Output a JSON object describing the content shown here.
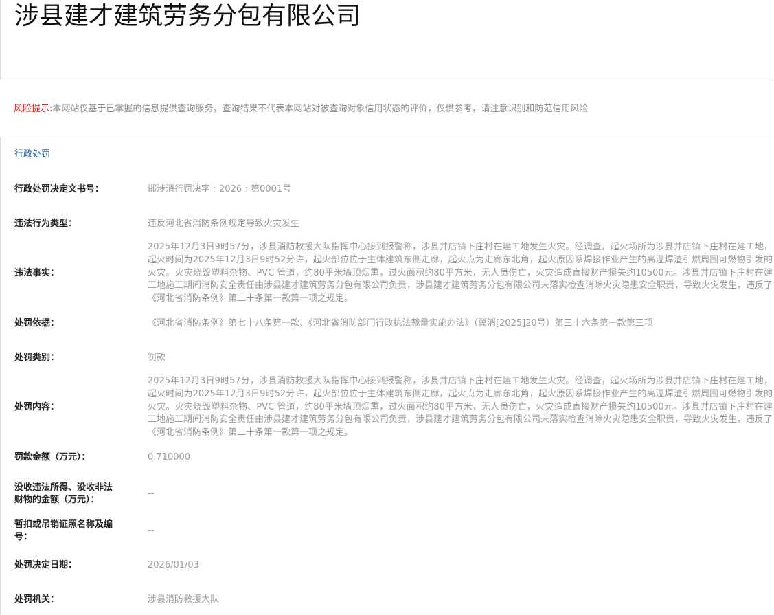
{
  "company": {
    "name": "涉县建才建筑劳务分包有限公司"
  },
  "risk": {
    "label": "风险提示:",
    "text": "本网站仅基于已掌握的信息提供查询服务，查询结果不代表本网站对被查询对象信用状态的评价，仅供参考，请注意识别和防范信用风险"
  },
  "section": {
    "title": "行政处罚"
  },
  "fields": [
    {
      "label": "行政处罚决定文书号：",
      "value": "邯涉消行罚决字﹝2026﹞第0001号"
    },
    {
      "label": "违法行为类型：",
      "value": "违反河北省消防条例规定导致火灾发生"
    },
    {
      "label": "违法事实：",
      "value": "2025年12月3日9时57分，涉县消防救援大队指挥中心接到报警称，涉县井店镇下庄村在建工地发生火灾。经调查，起火场所为涉县井店镇下庄村在建工地，起火时间为2025年12月3日9时52分许，起火部位位于主体建筑东侧走廊，起火点为走廊东北角，起火原因系焊接作业产生的高温焊渣引燃周围可燃物引发的火灾。火灾烧毁塑料杂物、PVC 管道，约80平米墙顶烟熏，过火面积约80平方米，无人员伤亡，火灾造成直接财产损失约10500元。涉县井店镇下庄村在建工地施工期间消防安全责任由涉县建才建筑劳务分包有限公司负责，涉县建才建筑劳务分包有限公司未落实检查消除火灾隐患安全职责，导致火灾发生，违反了《河北省消防条例》第二十条第一款第一项之规定。"
    },
    {
      "label": "处罚依据：",
      "value": "《河北省消防条例》第七十八条第一款、《河北省消防部门行政执法裁量实施办法》（冀消[2025]20号）第三十六条第一款第三项"
    },
    {
      "label": "处罚类别：",
      "value": "罚款"
    },
    {
      "label": "处罚内容：",
      "value": "2025年12月3日9时57分，涉县消防救援大队指挥中心接到报警称，涉县井店镇下庄村在建工地发生火灾。经调查，起火场所为涉县井店镇下庄村在建工地，起火时间为2025年12月3日9时52分许，起火部位位于主体建筑东侧走廊，起火点为走廊东北角，起火原因系焊接作业产生的高温焊渣引燃周围可燃物引发的火灾。火灾烧毁塑料杂物、PVC 管道，约80平米墙顶烟熏，过火面积约80平方米，无人员伤亡，火灾造成直接财产损失约10500元。涉县井店镇下庄村在建工地施工期间消防安全责任由涉县建才建筑劳务分包有限公司负责，涉县建才建筑劳务分包有限公司未落实检查消除火灾隐患安全职责，导致火灾发生，违反了《河北省消防条例》第二十条第一款第一项之规定。"
    },
    {
      "label": "罚款金额（万元）：",
      "value": "0.710000"
    },
    {
      "label": "没收违法所得、没收非法财物的金额（万元）：",
      "value": "--"
    },
    {
      "label": "暂扣或吊销证照名称及编号：",
      "value": "--"
    },
    {
      "label": "处罚决定日期：",
      "value": "2026/01/03"
    },
    {
      "label": "处罚机关：",
      "value": "涉县消防救援大队"
    }
  ]
}
